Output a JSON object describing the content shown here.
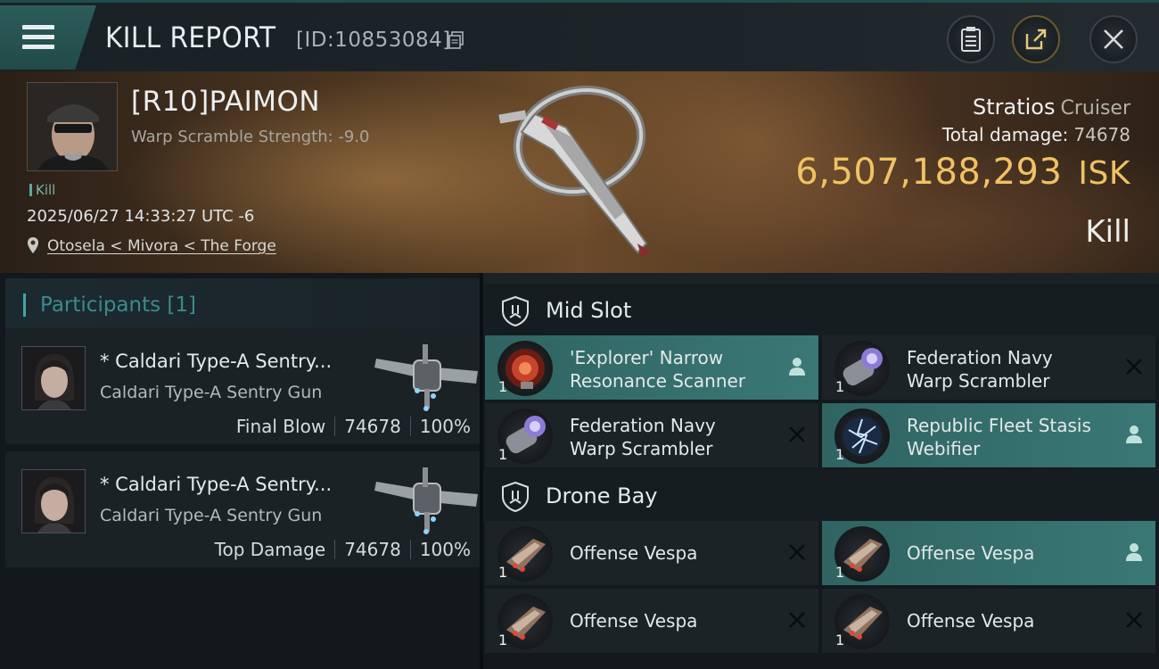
{
  "header": {
    "title": "KILL REPORT",
    "report_id": "[ID:10853084]"
  },
  "victim": {
    "name": "[R10]PAIMON",
    "scram_strength": "Warp Scramble Strength: -9.0",
    "kill_tag": "Kill",
    "datetime": "2025/06/27 14:33:27 UTC -6",
    "location": "Otosela < Mivora < The Forge",
    "ship_name": "Stratios",
    "ship_class": "Cruiser",
    "total_damage_label": "Total damage:",
    "total_damage": "74678",
    "isk_value": "6,507,188,293",
    "isk_currency": "ISK",
    "result": "Kill"
  },
  "participants": {
    "label": "Participants",
    "count": "[1]",
    "items": [
      {
        "name": "* Caldari Type-A Sentry...",
        "ship": "Caldari Type-A Sentry Gun",
        "role": "Final Blow",
        "damage": "74678",
        "percent": "100%"
      },
      {
        "name": "* Caldari Type-A Sentry...",
        "ship": "Caldari Type-A Sentry Gun",
        "role": "Top Damage",
        "damage": "74678",
        "percent": "100%"
      }
    ]
  },
  "sections": {
    "mid_slot": "Mid Slot",
    "drone_bay": "Drone Bay"
  },
  "mid_slots": [
    {
      "line1": "'Explorer' Narrow",
      "line2": "Resonance Scanner",
      "qty": "1",
      "status": "dropped"
    },
    {
      "line1": "Federation Navy",
      "line2": "Warp Scrambler",
      "qty": "1",
      "status": "destroyed"
    },
    {
      "line1": "Federation Navy",
      "line2": "Warp Scrambler",
      "qty": "1",
      "status": "destroyed"
    },
    {
      "line1": "Republic Fleet Stasis",
      "line2": "Webifier",
      "qty": "1",
      "status": "dropped"
    }
  ],
  "drone_slots": [
    {
      "line1": "Offense  Vespa",
      "qty": "1",
      "status": "destroyed"
    },
    {
      "line1": "Offense  Vespa",
      "qty": "1",
      "status": "dropped"
    },
    {
      "line1": "Offense  Vespa",
      "qty": "1",
      "status": "destroyed"
    },
    {
      "line1": "Offense  Vespa",
      "qty": "1",
      "status": "destroyed"
    }
  ],
  "colors": {
    "accent_teal": "#3a7875",
    "isk_gold": "#f0c264"
  }
}
